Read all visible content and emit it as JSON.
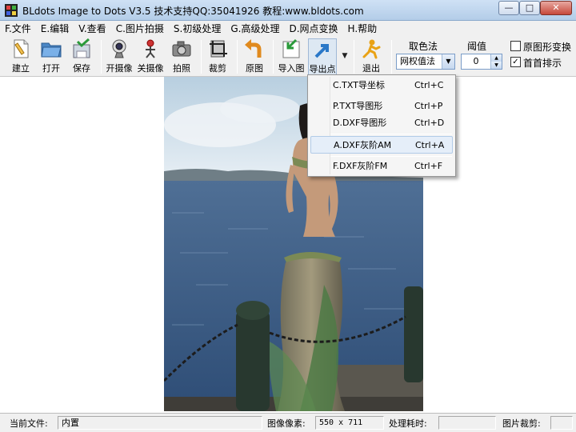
{
  "window": {
    "title": "BLdots Image to Dots V3.5 技术支持QQ:35041926 教程:www.bldots.com",
    "min_glyph": "—",
    "max_glyph": "□",
    "close_glyph": "✕"
  },
  "menu": [
    "F.文件",
    "E.编辑",
    "V.查看",
    "C.图片拍摄",
    "S.初级处理",
    "G.高级处理",
    "D.网点变换",
    "H.帮助"
  ],
  "toolbar": {
    "buttons": [
      {
        "label": "建立",
        "icon": "new-file-icon"
      },
      {
        "label": "打开",
        "icon": "open-folder-icon"
      },
      {
        "label": "保存",
        "icon": "save-icon"
      },
      {
        "label": "开摄像",
        "icon": "webcam-icon"
      },
      {
        "label": "关摄像",
        "icon": "webcam-off-icon"
      },
      {
        "label": "拍照",
        "icon": "camera-icon"
      },
      {
        "label": "裁剪",
        "icon": "crop-icon"
      },
      {
        "label": "原图",
        "icon": "undo-arrow-icon"
      },
      {
        "label": "导入图",
        "icon": "import-image-icon"
      },
      {
        "label": "导出点",
        "icon": "export-dots-icon"
      },
      {
        "label": "退出",
        "icon": "exit-runner-icon"
      }
    ],
    "color_method_label": "取色法",
    "color_method_value": "网权值法",
    "threshold_label": "阈值",
    "threshold_value": "0",
    "original_transform_label": "原图形变换",
    "original_transform_checked": false,
    "first_row_label": "首首排示",
    "first_row_checked": true
  },
  "export_menu": {
    "items": [
      {
        "label": "C.TXT导坐标",
        "shortcut": "Ctrl+C",
        "highlighted": false
      },
      {
        "label": "P.TXT导图形",
        "shortcut": "Ctrl+P",
        "highlighted": false
      },
      {
        "label": "D.DXF导图形",
        "shortcut": "Ctrl+D",
        "highlighted": false
      },
      {
        "label": "A.DXF灰阶AM",
        "shortcut": "Ctrl+A",
        "highlighted": true
      },
      {
        "label": "F.DXF灰阶FM",
        "shortcut": "Ctrl+F",
        "highlighted": false
      }
    ]
  },
  "status": {
    "current_file_label": "当前文件:",
    "current_file_value": "内置",
    "pixels_label": "图像像素:",
    "pixels_value": "550 x 711",
    "time_label": "处理耗时:",
    "time_value": "",
    "crop_label": "图片裁剪:",
    "crop_value": ""
  },
  "colors": {
    "accent": "#3c7fb1",
    "menu_highlight": "#e5eef9",
    "sea": "#3b5f8a",
    "sky": "#c9dbe9",
    "dress_green": "#4e7a45"
  }
}
